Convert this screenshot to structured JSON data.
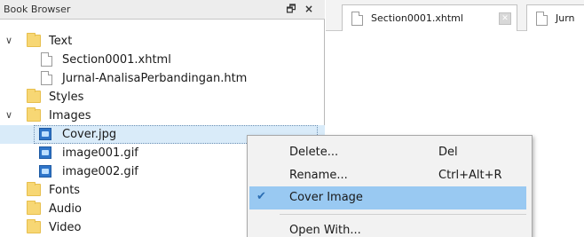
{
  "book_browser": {
    "title": "Book Browser",
    "float_icon_glyph": "🗗",
    "close_icon_glyph": "×",
    "tree": {
      "text_folder": {
        "label": "Text",
        "expanded": true
      },
      "section_file": {
        "label": "Section0001.xhtml"
      },
      "jurnal_file": {
        "label": "Jurnal-AnalisaPerbandingan.htm"
      },
      "styles_folder": {
        "label": "Styles"
      },
      "images_folder": {
        "label": "Images",
        "expanded": true
      },
      "cover_file": {
        "label": "Cover.jpg",
        "selected": true
      },
      "image001_file": {
        "label": "image001.gif"
      },
      "image002_file": {
        "label": "image002.gif"
      },
      "fonts_folder": {
        "label": "Fonts"
      },
      "audio_folder": {
        "label": "Audio"
      },
      "video_folder": {
        "label": "Video"
      }
    }
  },
  "editor_tabs": {
    "tab1": {
      "label": "Section0001.xhtml"
    },
    "tab2": {
      "label": "Jurn"
    }
  },
  "context_menu": {
    "delete": {
      "label": "Delete...",
      "shortcut": "Del"
    },
    "rename": {
      "label": "Rename...",
      "shortcut": "Ctrl+Alt+R"
    },
    "cover_image": {
      "label": "Cover Image",
      "checked": true,
      "check_glyph": "✔"
    },
    "open_with": {
      "label": "Open With..."
    }
  },
  "colors": {
    "menu_highlight": "#99c9f2",
    "folder": "#f7d774",
    "image_icon": "#2f75c9",
    "selection": "#d9ebf9"
  }
}
